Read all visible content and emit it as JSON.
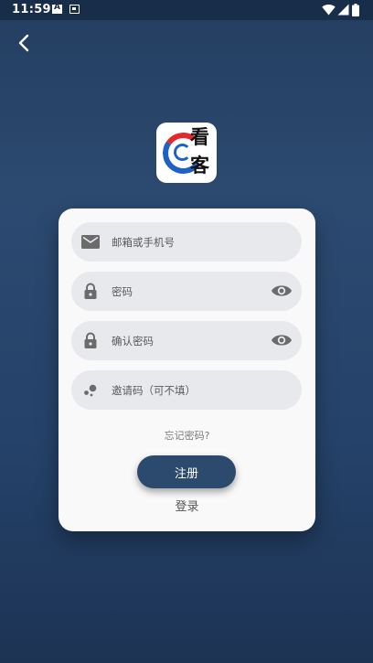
{
  "status_bar": {
    "time": "11:59",
    "icons": [
      "notification-a-icon",
      "notification-box-icon",
      "wifi-icon",
      "signal-icon",
      "battery-icon"
    ],
    "color": "#182d4a"
  },
  "nav": {
    "back_icon": "chevron-left-icon"
  },
  "logo": {
    "chars": [
      "看",
      "客"
    ],
    "colors": {
      "red": "#e22a2d",
      "blue": "#1e62c4"
    }
  },
  "form": {
    "email": {
      "placeholder": "邮箱或手机号",
      "value": "",
      "icon": "mail-icon"
    },
    "password": {
      "placeholder": "密码",
      "value": "",
      "icon": "lock-icon",
      "toggle_icon": "eye-icon"
    },
    "confirm_password": {
      "placeholder": "确认密码",
      "value": "",
      "icon": "lock-icon",
      "toggle_icon": "eye-icon"
    },
    "invite_code": {
      "placeholder": "邀请码（可不填）",
      "value": "",
      "icon": "invite-icon"
    },
    "forgot_password": "忘记密码?",
    "register_button": "注册",
    "login_link": "登录"
  },
  "colors": {
    "background_top": "#243e60",
    "background_bottom": "#1d3354",
    "card": "#f9f9f9",
    "field": "#e8e9ec",
    "accent": "#2c4a6e"
  }
}
